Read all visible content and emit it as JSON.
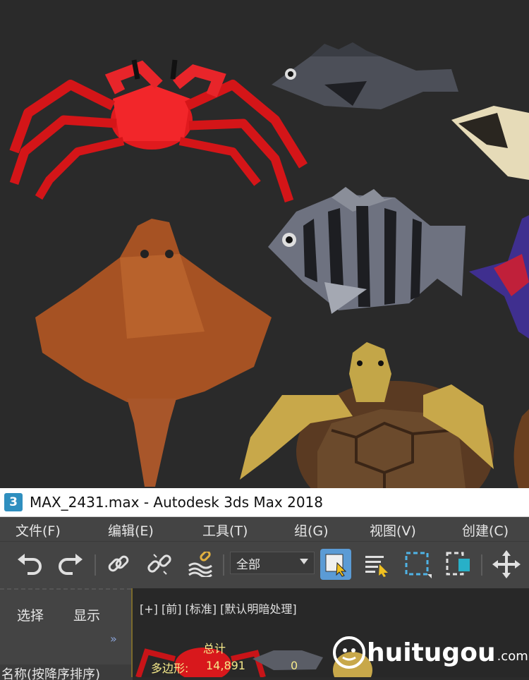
{
  "window": {
    "app_logo": "3",
    "title": "MAX_2431.max - Autodesk 3ds Max 2018"
  },
  "menu": {
    "items": [
      "文件(F)",
      "编辑(E)",
      "工具(T)",
      "组(G)",
      "视图(V)",
      "创建(C)"
    ]
  },
  "toolbar": {
    "undo_icon": "undo-icon",
    "redo_icon": "redo-icon",
    "link_icon": "link-icon",
    "unlink_icon": "unlink-icon",
    "bind_space_warp_icon": "bind-space-warp-icon",
    "filter_value": "全部",
    "select_icon": "select-object-icon",
    "select_by_name_icon": "select-by-name-icon",
    "rect_region_icon": "rectangular-region-icon",
    "window_crossing_icon": "window-crossing-icon",
    "move_icon": "move-icon",
    "accent_color": "#5b9bd5"
  },
  "command_panel": {
    "tab_select": "选择",
    "tab_display": "显示",
    "expand": "»",
    "name_sort": "名称(按降序排序)"
  },
  "viewport": {
    "label": "[+] [前] [标准] [默认明暗处理]",
    "stats_total_label": "总计",
    "stats_poly_label": "多边形:",
    "stats_poly_value": "14,891",
    "stats_selected_value": "0"
  },
  "watermark": {
    "text": "huitugou",
    "suffix": ".com"
  }
}
